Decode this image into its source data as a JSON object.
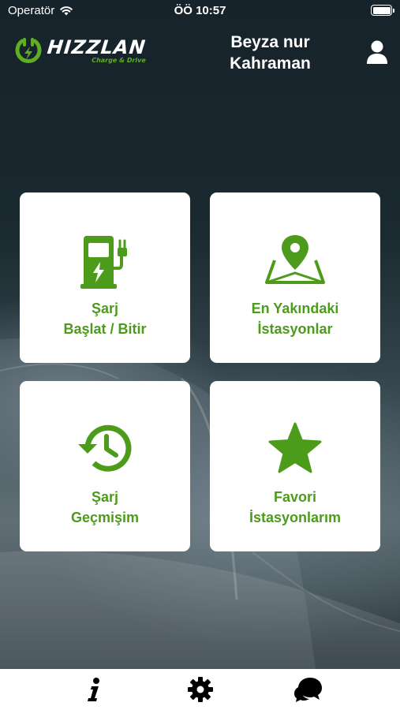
{
  "status_bar": {
    "carrier": "Operatör",
    "time": "ÖÖ 10:57"
  },
  "header": {
    "logo_name": "HIZZLAN",
    "logo_tagline": "Charge & Drive",
    "user_name_line1": "Beyza nur",
    "user_name_line2": "Kahraman"
  },
  "menu": {
    "start_stop": {
      "line1": "Şarj",
      "line2": "Başlat / Bitir",
      "icon": "charging-station-icon"
    },
    "nearest": {
      "line1": "En Yakındaki",
      "line2": "İstasyonlar",
      "icon": "map-pin-icon"
    },
    "history": {
      "line1": "Şarj",
      "line2": "Geçmişim",
      "icon": "history-icon"
    },
    "favorites": {
      "line1": "Favori",
      "line2": "İstasyonlarım",
      "icon": "star-icon"
    }
  },
  "tabbar": {
    "items": [
      "info-icon",
      "gear-icon",
      "chat-icon"
    ]
  },
  "colors": {
    "accent": "#4d9b1b",
    "logo_green": "#5fae23",
    "background": "#1c2a31"
  }
}
